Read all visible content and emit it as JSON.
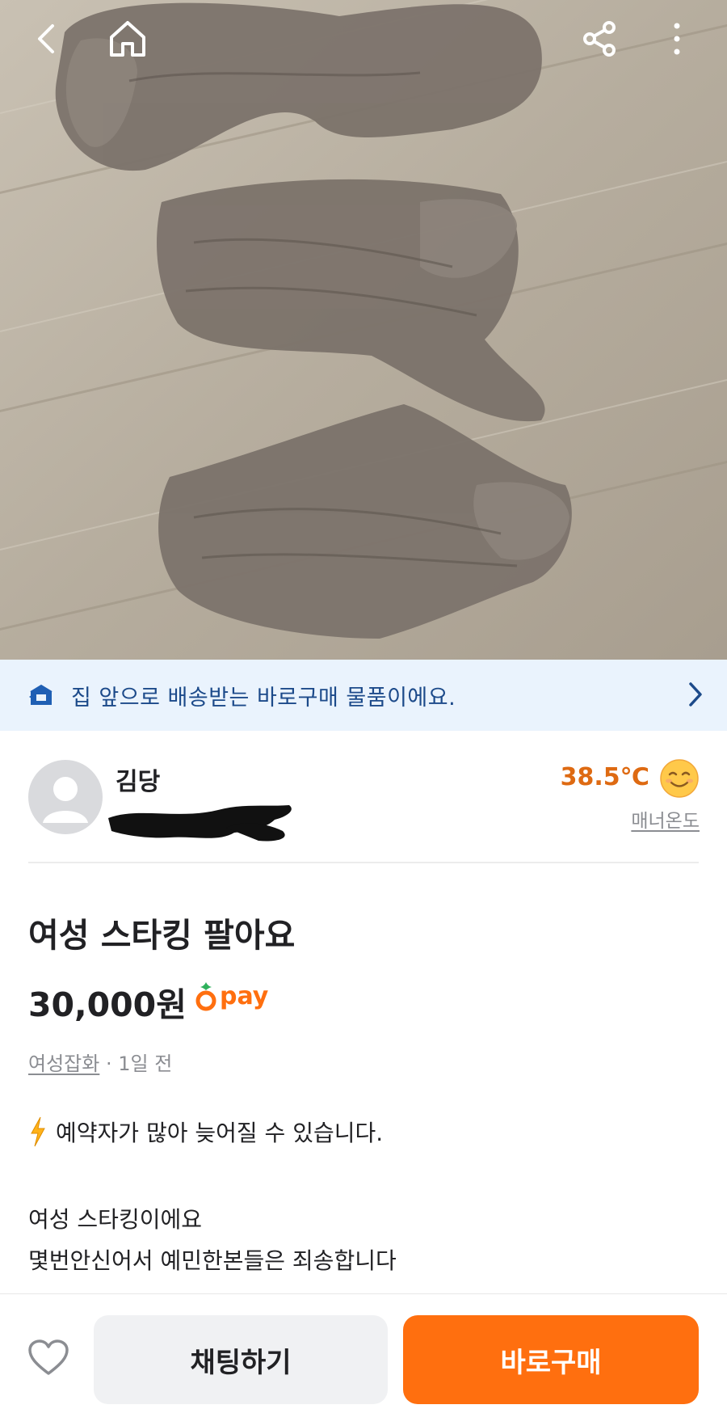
{
  "header": {
    "back_icon": "back-arrow-icon",
    "home_icon": "home-icon",
    "share_icon": "share-icon",
    "more_icon": "more-vertical-icon"
  },
  "delivery_banner": {
    "text": "집 앞으로 배송받는 바로구매 물품이에요.",
    "icon": "delivery-box-icon"
  },
  "seller": {
    "name": "김당",
    "temperature": "38.5℃",
    "manner_label": "매너온도"
  },
  "item": {
    "title": "여성 스타킹 팔아요",
    "price": "30,000원",
    "pay_label": "pay",
    "category": "여성잡화",
    "time_ago": " · 1일 전",
    "notice": "예약자가 많아 늦어질 수 있습니다.",
    "description_lines": [
      "여성 스타킹이에요",
      "몇번안신어서 예민한본들은 죄송합니다"
    ]
  },
  "bottom_bar": {
    "chat_label": "채팅하기",
    "buy_label": "바로구매"
  },
  "colors": {
    "accent": "#ff6f0f",
    "banner_bg": "#eaf3fd",
    "banner_text": "#1c4a8a",
    "temperature": "#de6a12"
  }
}
